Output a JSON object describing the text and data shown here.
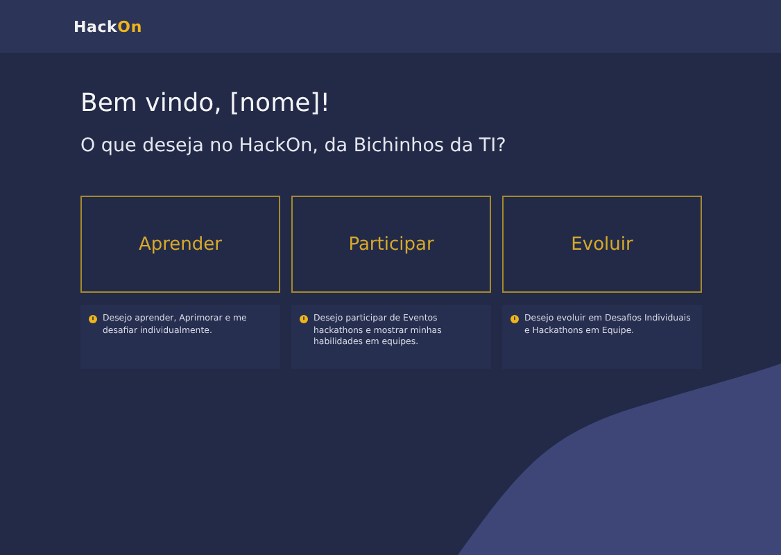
{
  "logo": {
    "text": "Hack",
    "accent": "On"
  },
  "greeting": "Bem vindo, [nome]!",
  "question": "O que deseja no HackOn, da Bichinhos da TI?",
  "options": [
    {
      "label": "Aprender",
      "description": "Desejo aprender, Aprimorar e me desafiar individualmente."
    },
    {
      "label": "Participar",
      "description": "Desejo participar de Eventos hackathons e mostrar minhas habilidades em equipes."
    },
    {
      "label": "Evoluir",
      "description": "Desejo evoluir em Desafios Individuais e Hackathons em Equipe."
    }
  ]
}
